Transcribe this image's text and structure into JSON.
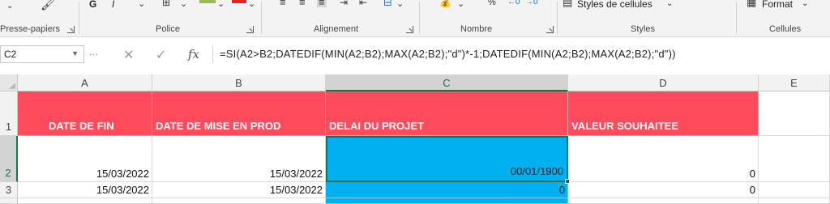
{
  "ribbon": {
    "groups": [
      {
        "label": "Presse-papiers"
      },
      {
        "label": "Police"
      },
      {
        "label": "Alignement"
      },
      {
        "label": "Nombre"
      },
      {
        "label": "Styles"
      },
      {
        "label": "Cellules"
      }
    ],
    "styles_button": "Styles de cellules",
    "format_button": "Format",
    "bold_glyph": "G",
    "italic_glyph": "I"
  },
  "formula_bar": {
    "name_box": "C2",
    "fx_label": "fx",
    "cancel_glyph": "✕",
    "enter_glyph": "✓",
    "formula": "=SI(A2>B2;DATEDIF(MIN(A2;B2);MAX(A2;B2);\"d\")*-1;DATEDIF(MIN(A2;B2);MAX(A2;B2);\"d\"))"
  },
  "sheet": {
    "columns": [
      "A",
      "B",
      "C",
      "D",
      "E"
    ],
    "rows": [
      "1",
      "2",
      "3"
    ],
    "header_row": [
      "DATE DE FIN",
      "DATE DE MISE EN PROD",
      "DELAI DU PROJET",
      "VALEUR SOUHAITEE"
    ],
    "data": [
      {
        "a": "15/03/2022",
        "b": "15/03/2022",
        "c": "00/01/1900",
        "d": "0"
      },
      {
        "a": "15/03/2022",
        "b": "15/03/2022",
        "c": "0",
        "d": "0"
      }
    ],
    "active_cell": "C2",
    "colors": {
      "header_fill": "#ff4b5c",
      "result_fill": "#00b0f0",
      "selection": "#217346"
    }
  }
}
